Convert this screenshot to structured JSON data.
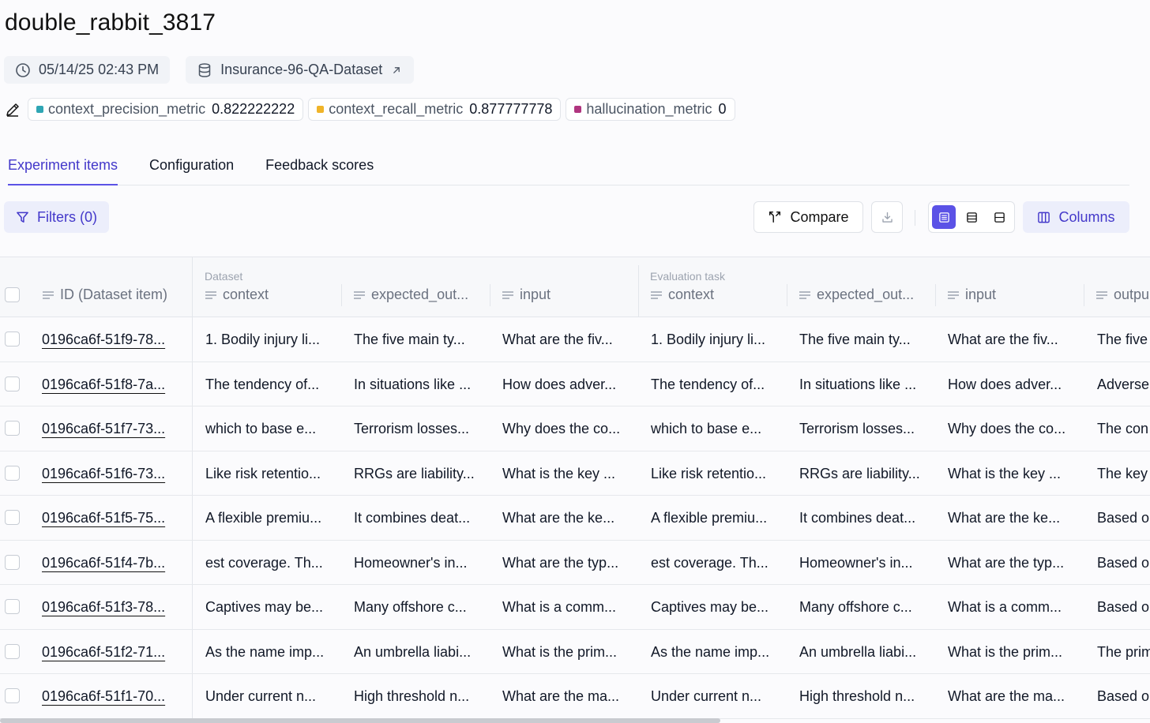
{
  "experiment": {
    "name": "double_rabbit_3817",
    "timestamp": "05/14/25 02:43 PM",
    "dataset": "Insurance-96-QA-Dataset"
  },
  "metrics": [
    {
      "name": "context_precision_metric",
      "value": "0.822222222",
      "color": "#2fa6b4"
    },
    {
      "name": "context_recall_metric",
      "value": "0.877777778",
      "color": "#f0b429"
    },
    {
      "name": "hallucination_metric",
      "value": "0",
      "color": "#b0357f"
    }
  ],
  "tabs": [
    "Experiment items",
    "Configuration",
    "Feedback scores"
  ],
  "toolbar": {
    "filters_label": "Filters (0)",
    "compare_label": "Compare",
    "columns_label": "Columns"
  },
  "table": {
    "groups": {
      "dataset": "Dataset",
      "evaluation": "Evaluation task"
    },
    "headers": [
      "ID (Dataset item)",
      "context",
      "expected_out...",
      "input",
      "context",
      "expected_out...",
      "input",
      "outpu"
    ],
    "rows": [
      [
        "0196ca6f-51f9-78...",
        "1. Bodily injury li...",
        "The five main ty...",
        "What are the fiv...",
        "1. Bodily injury li...",
        "The five main ty...",
        "What are the fiv...",
        "The five"
      ],
      [
        "0196ca6f-51f8-7a...",
        "The tendency of...",
        "In situations like ...",
        "How does adver...",
        "The tendency of...",
        "In situations like ...",
        "How does adver...",
        "Adverse"
      ],
      [
        "0196ca6f-51f7-73...",
        "which to base e...",
        "Terrorism losses...",
        "Why does the co...",
        "which to base e...",
        "Terrorism losses...",
        "Why does the co...",
        "The con"
      ],
      [
        "0196ca6f-51f6-73...",
        "Like risk retentio...",
        "RRGs are liability...",
        "What is the key ...",
        "Like risk retentio...",
        "RRGs are liability...",
        "What is the key ...",
        "The key"
      ],
      [
        "0196ca6f-51f5-75...",
        "A flexible premiu...",
        "It combines deat...",
        "What are the ke...",
        "A flexible premiu...",
        "It combines deat...",
        "What are the ke...",
        "Based o"
      ],
      [
        "0196ca6f-51f4-7b...",
        "est coverage. Th...",
        "Homeowner's in...",
        "What are the typ...",
        "est coverage. Th...",
        "Homeowner's in...",
        "What are the typ...",
        "Based o"
      ],
      [
        "0196ca6f-51f3-78...",
        "Captives may be...",
        "Many offshore c...",
        "What is a comm...",
        "Captives may be...",
        "Many offshore c...",
        "What is a comm...",
        "Based o"
      ],
      [
        "0196ca6f-51f2-71...",
        "As the name imp...",
        "An umbrella liabi...",
        "What is the prim...",
        "As the name imp...",
        "An umbrella liabi...",
        "What is the prim...",
        "The prim"
      ],
      [
        "0196ca6f-51f1-70...",
        "Under current n...",
        "High threshold n...",
        "What are the ma...",
        "Under current n...",
        "High threshold n...",
        "What are the ma...",
        "Based o"
      ]
    ]
  }
}
